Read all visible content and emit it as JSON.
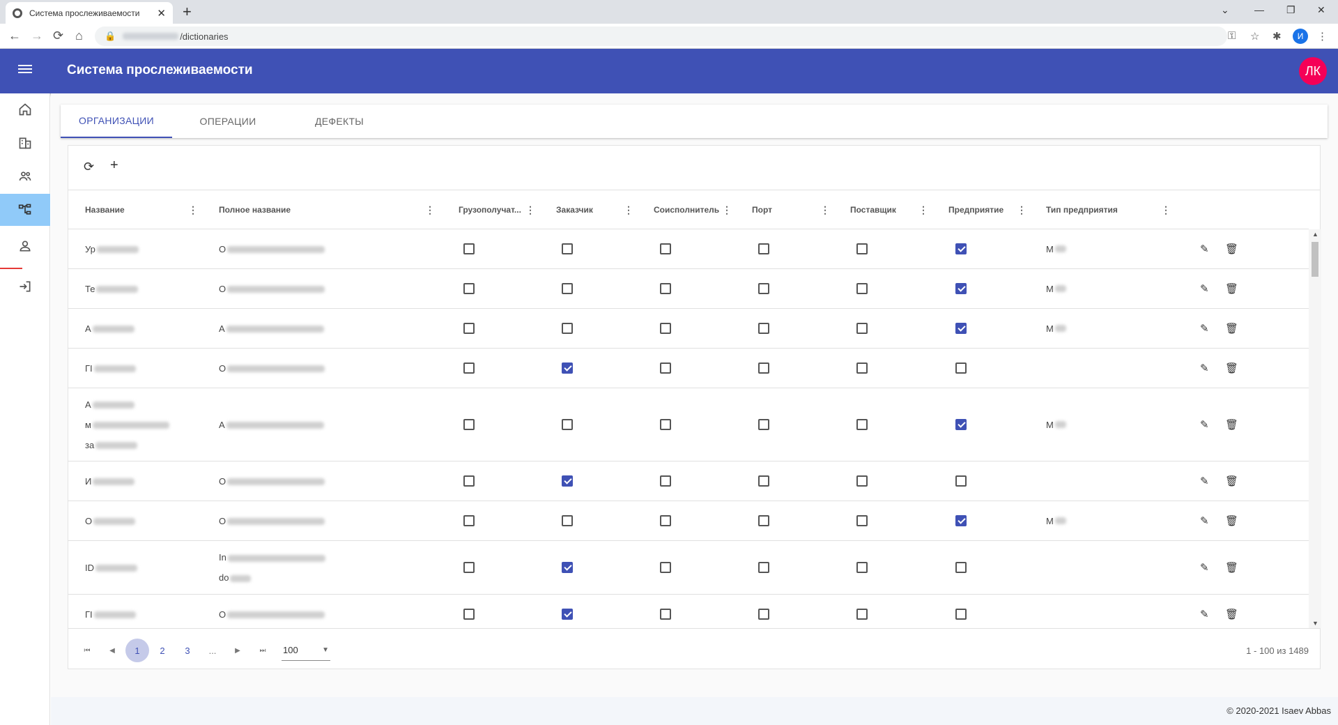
{
  "browser": {
    "tab_title": "Система прослеживаемости",
    "url_path": "/dictionaries",
    "profile_initial": "И"
  },
  "app": {
    "title": "Система прослеживаемости",
    "avatar": "ЛК",
    "colors": {
      "primary": "#3f51b5",
      "accent": "#f50057",
      "active_nav": "#90caf9"
    }
  },
  "nav": [
    "home-icon",
    "buildings-icon",
    "people-icon",
    "hierarchy-icon",
    "person-icon",
    "logout-icon"
  ],
  "tabs": [
    "ОРГАНИЗАЦИИ",
    "ОПЕРАЦИИ",
    "ДЕФЕКТЫ"
  ],
  "toolbar": {
    "refresh": "⟳",
    "add": "+"
  },
  "grid": {
    "columns": [
      "Название",
      "Полное название",
      "Грузополучат...",
      "Заказчик",
      "Соисполнитель",
      "Порт",
      "Поставщик",
      "Предприятие",
      "Тип предприятия"
    ],
    "rows": [
      {
        "name": "Ур",
        "full": "О",
        "flags": [
          false,
          false,
          false,
          false,
          false,
          true
        ],
        "type": "М"
      },
      {
        "name": "Те",
        "full": "О",
        "flags": [
          false,
          false,
          false,
          false,
          false,
          true
        ],
        "type": "М"
      },
      {
        "name": "А",
        "full": "А",
        "flags": [
          false,
          false,
          false,
          false,
          false,
          true
        ],
        "type": "М"
      },
      {
        "name": "ГІ",
        "full": "О",
        "flags": [
          false,
          true,
          false,
          false,
          false,
          false
        ],
        "type": ""
      },
      {
        "name": "А",
        "name2": "м",
        "name3": "за",
        "full": "А",
        "flags": [
          false,
          false,
          false,
          false,
          false,
          true
        ],
        "type": "М"
      },
      {
        "name": "И",
        "full": "О",
        "flags": [
          false,
          true,
          false,
          false,
          false,
          false
        ],
        "type": ""
      },
      {
        "name": "О",
        "full": "О",
        "flags": [
          false,
          false,
          false,
          false,
          false,
          true
        ],
        "type": "М"
      },
      {
        "name": "ID",
        "full": "In",
        "full2": "do",
        "flags": [
          false,
          true,
          false,
          false,
          false,
          false
        ],
        "type": ""
      },
      {
        "name": "ГІ",
        "full": "О",
        "flags": [
          false,
          true,
          false,
          false,
          false,
          false
        ],
        "type": ""
      }
    ]
  },
  "pager": {
    "pages": [
      "1",
      "2",
      "3",
      "..."
    ],
    "page_size": "100",
    "info": "1 - 100 из 1489"
  },
  "footer": {
    "copyright": "© 2020-2021 Isaev Abbas"
  }
}
